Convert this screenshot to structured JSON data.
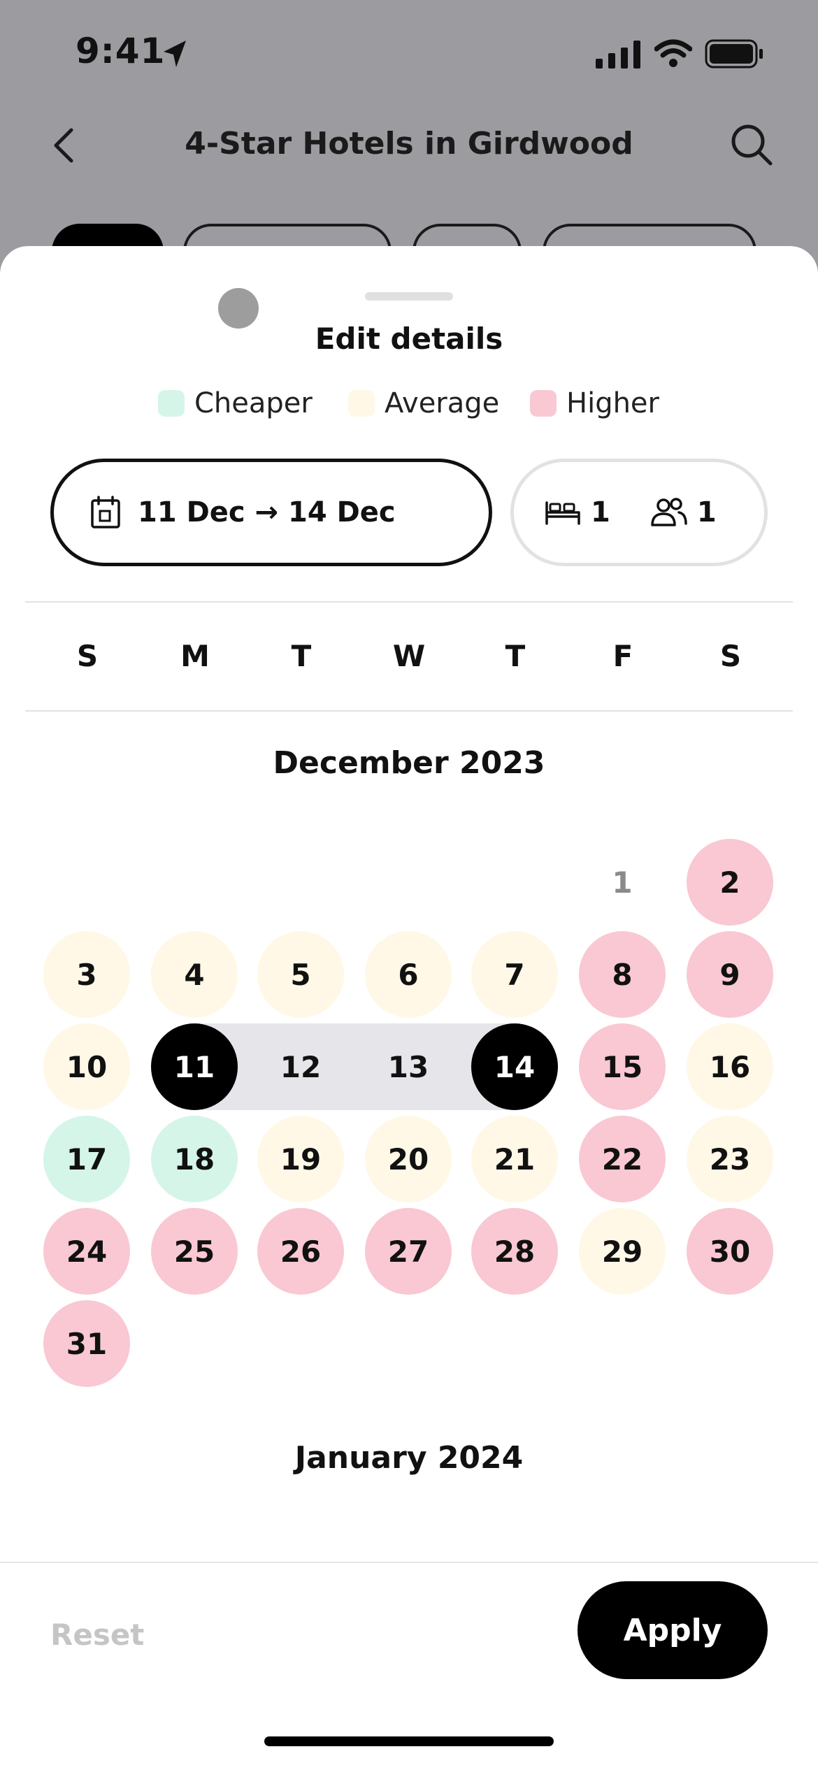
{
  "status_bar": {
    "time": "9:41"
  },
  "nav": {
    "title": "4-Star Hotels in Girdwood"
  },
  "sheet": {
    "title": "Edit details",
    "legend": [
      {
        "label": "Cheaper",
        "color": "#d5f5e9"
      },
      {
        "label": "Average",
        "color": "#fff8e6"
      },
      {
        "label": "Higher",
        "color": "#f9c8d2"
      }
    ],
    "dates_label": "11 Dec → 14 Dec",
    "rooms": "1",
    "guests": "1"
  },
  "calendar": {
    "weekdays": [
      "S",
      "M",
      "T",
      "W",
      "T",
      "F",
      "S"
    ],
    "month1": "December 2023",
    "month2": "January 2024",
    "days": [
      "1",
      "2",
      "3",
      "4",
      "5",
      "6",
      "7",
      "8",
      "9",
      "10",
      "11",
      "12",
      "13",
      "14",
      "15",
      "16",
      "17",
      "18",
      "19",
      "20",
      "21",
      "22",
      "23",
      "24",
      "25",
      "26",
      "27",
      "28",
      "29",
      "30",
      "31"
    ],
    "price_levels": [
      "none",
      "higher",
      "average",
      "average",
      "average",
      "average",
      "average",
      "higher",
      "higher",
      "average",
      "selected",
      "range",
      "range",
      "selected",
      "higher",
      "average",
      "cheaper",
      "cheaper",
      "average",
      "average",
      "average",
      "higher",
      "average",
      "higher",
      "higher",
      "higher",
      "higher",
      "higher",
      "average",
      "higher",
      "higher"
    ]
  },
  "footer": {
    "reset": "Reset",
    "apply": "Apply"
  }
}
